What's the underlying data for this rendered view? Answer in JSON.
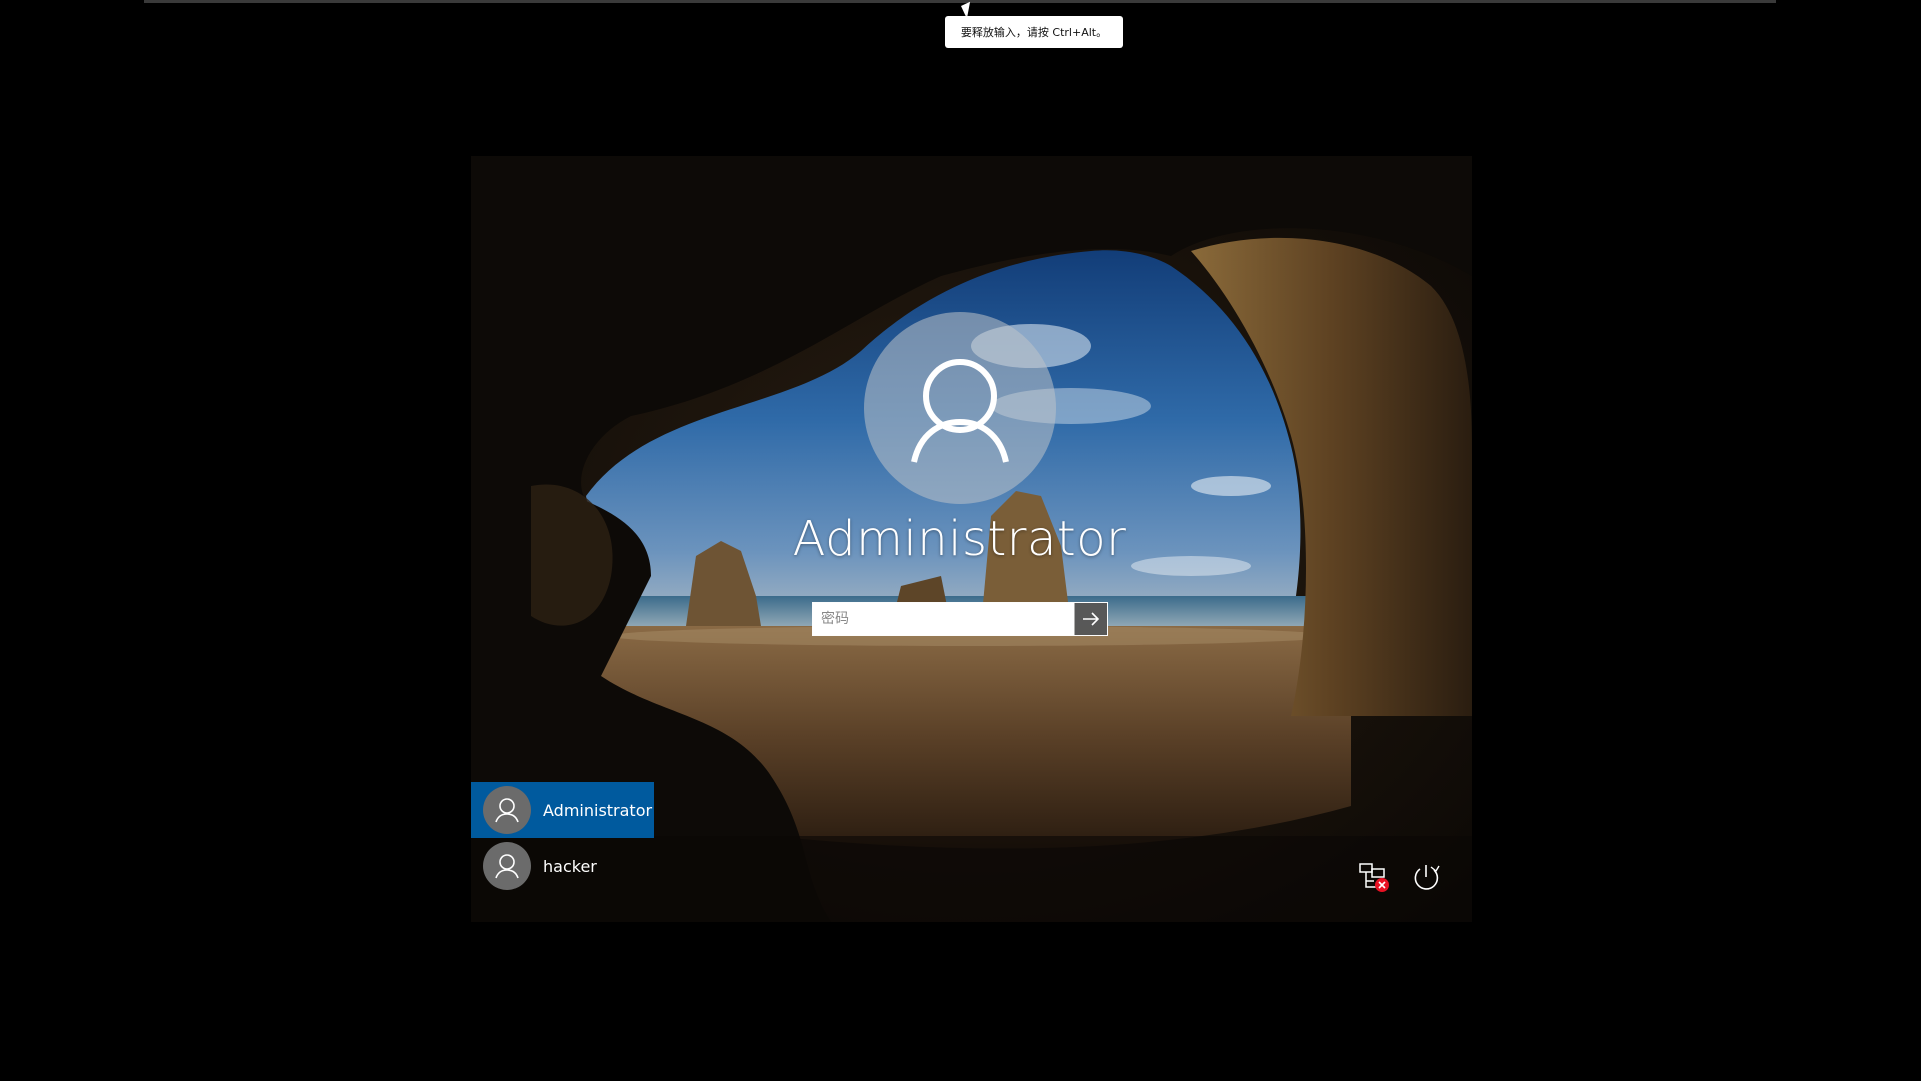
{
  "window": {
    "tooltip_text": "要释放输入，请按 Ctrl+Alt。"
  },
  "lock_screen": {
    "selected_user": "Administrator",
    "password_placeholder": "密码",
    "users": [
      {
        "name": "Administrator",
        "selected": true
      },
      {
        "name": "hacker",
        "selected": false
      }
    ],
    "icons": {
      "network": "network-disconnected-icon",
      "power": "power-icon",
      "submit": "arrow-right-icon",
      "avatar": "user-avatar-icon"
    },
    "colors": {
      "selected_user_bg": "#005a9e",
      "avatar_bg": "#6b6b6b",
      "network_error": "#e81123"
    }
  }
}
